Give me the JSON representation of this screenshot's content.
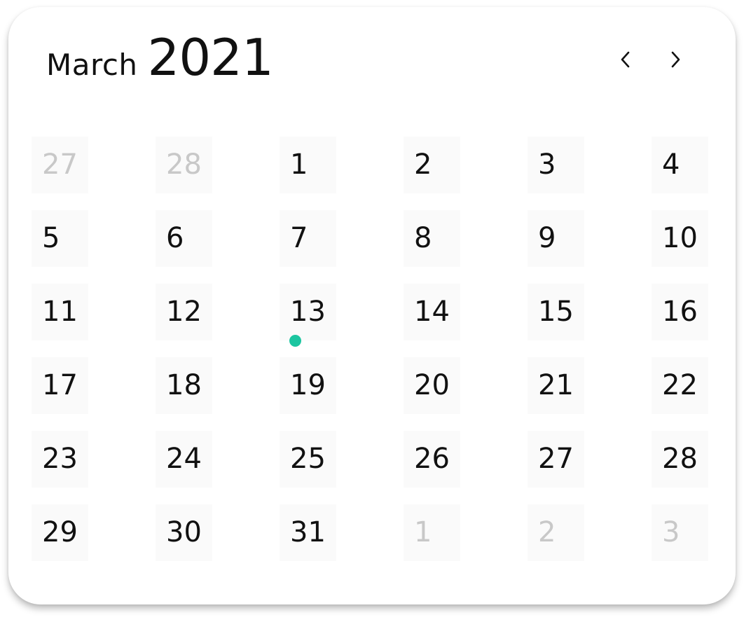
{
  "header": {
    "month": "March",
    "year": "2021",
    "prev_icon": "chevron-left-icon",
    "next_icon": "chevron-right-icon"
  },
  "days": [
    {
      "label": "27",
      "muted": true
    },
    {
      "label": "28",
      "muted": true
    },
    {
      "label": "1",
      "muted": false
    },
    {
      "label": "2",
      "muted": false
    },
    {
      "label": "3",
      "muted": false
    },
    {
      "label": "4",
      "muted": false
    },
    {
      "label": "5",
      "muted": false
    },
    {
      "label": "6",
      "muted": false
    },
    {
      "label": "7",
      "muted": false
    },
    {
      "label": "8",
      "muted": false
    },
    {
      "label": "9",
      "muted": false
    },
    {
      "label": "10",
      "muted": false
    },
    {
      "label": "11",
      "muted": false
    },
    {
      "label": "12",
      "muted": false
    },
    {
      "label": "13",
      "muted": false,
      "event_dot": true
    },
    {
      "label": "14",
      "muted": false
    },
    {
      "label": "15",
      "muted": false
    },
    {
      "label": "16",
      "muted": false
    },
    {
      "label": "17",
      "muted": false
    },
    {
      "label": "18",
      "muted": false
    },
    {
      "label": "19",
      "muted": false
    },
    {
      "label": "20",
      "muted": false
    },
    {
      "label": "21",
      "muted": false
    },
    {
      "label": "22",
      "muted": false
    },
    {
      "label": "23",
      "muted": false
    },
    {
      "label": "24",
      "muted": false
    },
    {
      "label": "25",
      "muted": false
    },
    {
      "label": "26",
      "muted": false
    },
    {
      "label": "27",
      "muted": false
    },
    {
      "label": "28",
      "muted": false
    },
    {
      "label": "29",
      "muted": false
    },
    {
      "label": "30",
      "muted": false
    },
    {
      "label": "31",
      "muted": false
    },
    {
      "label": "1",
      "muted": true
    },
    {
      "label": "2",
      "muted": true
    },
    {
      "label": "3",
      "muted": true
    }
  ],
  "colors": {
    "text": "#111111",
    "muted_text": "#c8c8c8",
    "cell_bg": "#fafafa",
    "event_dot": "#1cc5a0"
  }
}
